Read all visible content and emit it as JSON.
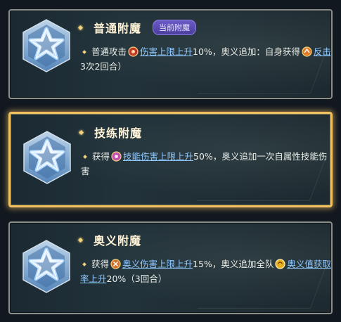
{
  "cards": [
    {
      "title": "普通附魔",
      "badge": "当前附魔",
      "selected": false,
      "desc": {
        "prefix": "普通攻击",
        "kw1": "伤害上限上升",
        "mid": "10%，奥义追加：自身获得",
        "kw2": "反击",
        "suffix": "3次2回合）"
      }
    },
    {
      "title": "技练附魔",
      "selected": true,
      "desc": {
        "prefix": "获得",
        "kw1": "技能伤害上限上升",
        "suffix": "50%，奥义追加一次自属性技能伤害"
      }
    },
    {
      "title": "奥义附魔",
      "selected": false,
      "desc": {
        "prefix": "获得",
        "kw1": "奥义伤害上限上升",
        "mid": "15%，奥义追加全队",
        "kw2": "奥义值获取率上升",
        "suffix": "20%（3回合）"
      }
    }
  ],
  "icons": [
    "star-emblem-icon",
    "attack-orb-icon",
    "counter-orb-icon",
    "skill-orb-icon",
    "ougi-orb-icon",
    "ougi-gauge-icon"
  ],
  "colors": {
    "gold": "#f3d27a",
    "link": "#8ec8ff",
    "badge": "#5a4cb8",
    "selected_border": "#f0c060"
  }
}
